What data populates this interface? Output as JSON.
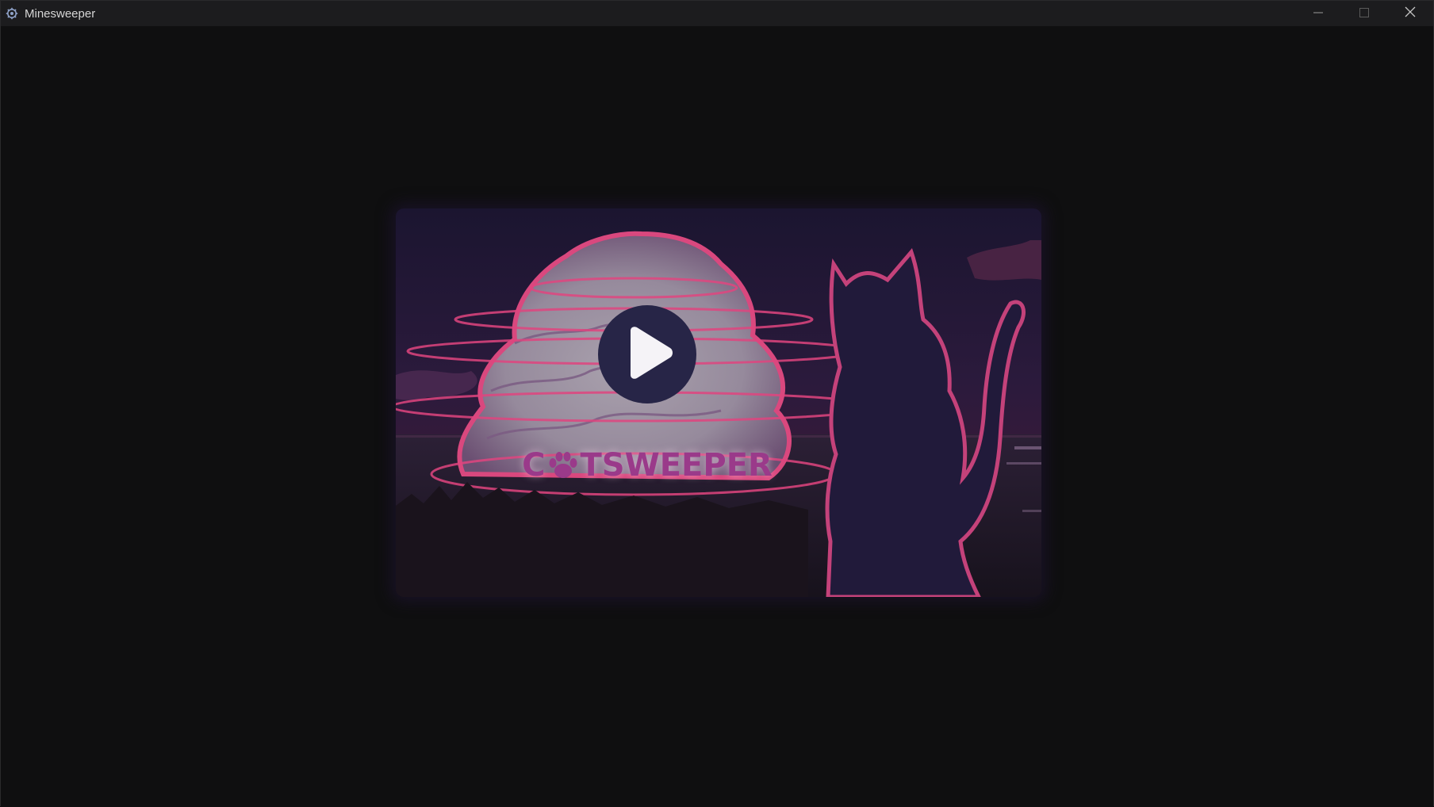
{
  "window": {
    "title": "Minesweeper",
    "icons": {
      "app": "gear-app-icon",
      "minimize": "minimize-icon",
      "maximize": "maximize-icon",
      "close": "close-icon"
    }
  },
  "splash": {
    "brand_prefix": "C",
    "brand_suffix": "TSWEEPER",
    "brand_logo_icon": "paw-icon",
    "play_icon": "play-icon",
    "colors": {
      "brand_text": "#9a3a8a",
      "play_button": "#272547",
      "accent_pink": "#e0457f"
    }
  }
}
